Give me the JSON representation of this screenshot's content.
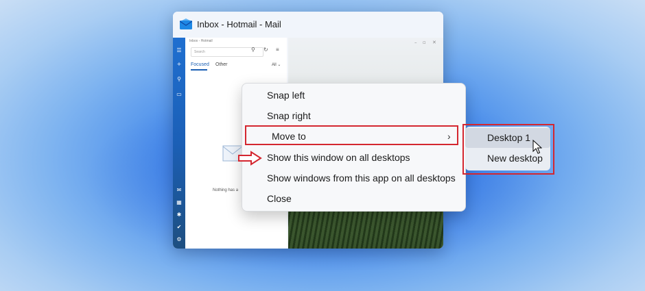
{
  "window": {
    "title": "Inbox - Hotmail - Mail",
    "icon": "mail-envelope-icon"
  },
  "mail_app": {
    "list_header": "Inbox - Hotmail",
    "search_placeholder": "Search",
    "tabs": [
      {
        "label": "Focused",
        "active": true
      },
      {
        "label": "Other",
        "active": false
      }
    ],
    "filter_label": "All",
    "empty_message": "Nothing has a"
  },
  "context_menu": {
    "items": [
      {
        "label": "Snap left"
      },
      {
        "label": "Snap right"
      },
      {
        "label": "Move to",
        "has_submenu": true,
        "highlighted": true
      },
      {
        "label": "Show this window on all desktops"
      },
      {
        "label": "Show windows from this app on all desktops"
      },
      {
        "label": "Close"
      }
    ]
  },
  "submenu": {
    "items": [
      {
        "label": "Desktop 1",
        "hovered": true
      },
      {
        "label": "New desktop"
      }
    ]
  },
  "colors": {
    "highlight_box": "#d4262f",
    "accent": "#1a5fb4"
  }
}
